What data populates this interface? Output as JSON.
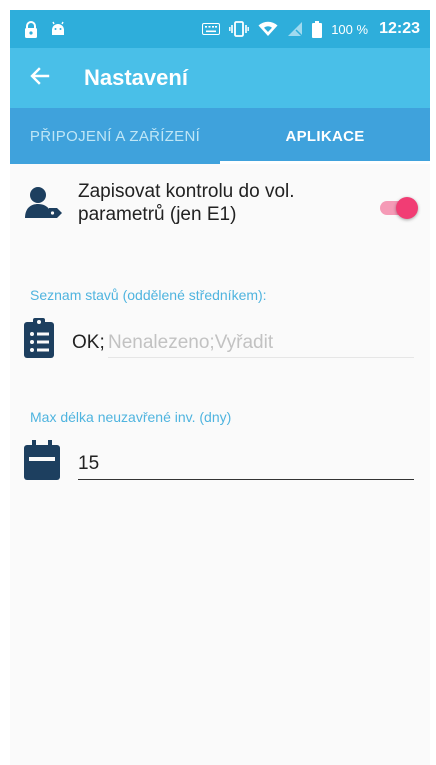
{
  "status_bar": {
    "battery_percent": "100 %",
    "time": "12:23",
    "icons": [
      "lock-icon",
      "android-icon",
      "keyboard-icon",
      "vibrate-icon",
      "wifi-icon",
      "no-signal-icon",
      "battery-icon"
    ]
  },
  "toolbar": {
    "title": "Nastavení",
    "back_icon": "arrow-left-icon"
  },
  "tabs": [
    {
      "label": "PŘIPOJENÍ A ZAŘÍZENÍ",
      "active": false
    },
    {
      "label": "APLIKACE",
      "active": true
    }
  ],
  "settings": {
    "write_check": {
      "label": "Zapisovat kontrolu do vol. parametrů (jen E1)",
      "enabled": true,
      "icon": "user-tag-icon"
    },
    "states": {
      "label": "Seznam stavů (oddělené středníkem):",
      "prefix": "OK;",
      "placeholder": "Nenalezeno;Vyřadit",
      "value": "",
      "icon": "clipboard-list-icon"
    },
    "max_days": {
      "label": "Max délka neuzavřené inv. (dny)",
      "value": "15",
      "icon": "calendar-icon"
    }
  },
  "colors": {
    "status_bar": "#2eaedb",
    "toolbar": "#49bfe8",
    "tabs": "#3fa2dc",
    "accent_label": "#4fb4df",
    "toggle_on": "#f13d74",
    "icon_dark": "#1d3f5f"
  }
}
